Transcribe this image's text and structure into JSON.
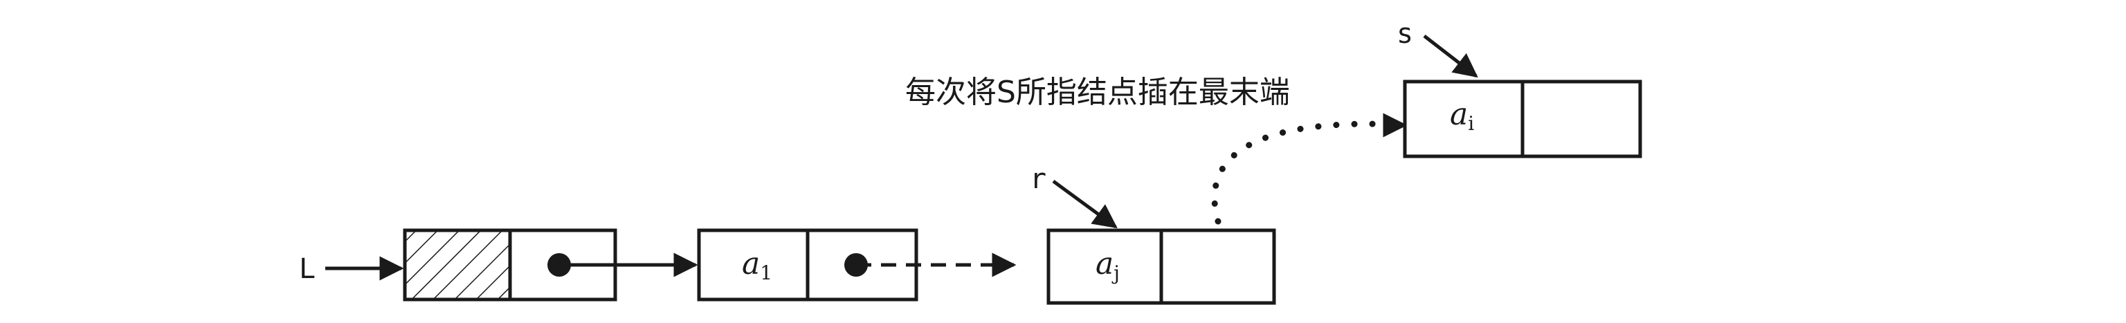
{
  "labels": {
    "head_pointer": "L",
    "tail_pointer": "r",
    "new_pointer": "s",
    "caption": "每次将S所指结点插在最末端"
  },
  "nodes": {
    "node_a1": {
      "data": "a",
      "sub": "1"
    },
    "node_aj": {
      "data": "a",
      "sub": "j"
    },
    "node_ai": {
      "data": "a",
      "sub": "i"
    }
  },
  "colors": {
    "ink": "#1a1a1a",
    "background": "#ffffff"
  }
}
